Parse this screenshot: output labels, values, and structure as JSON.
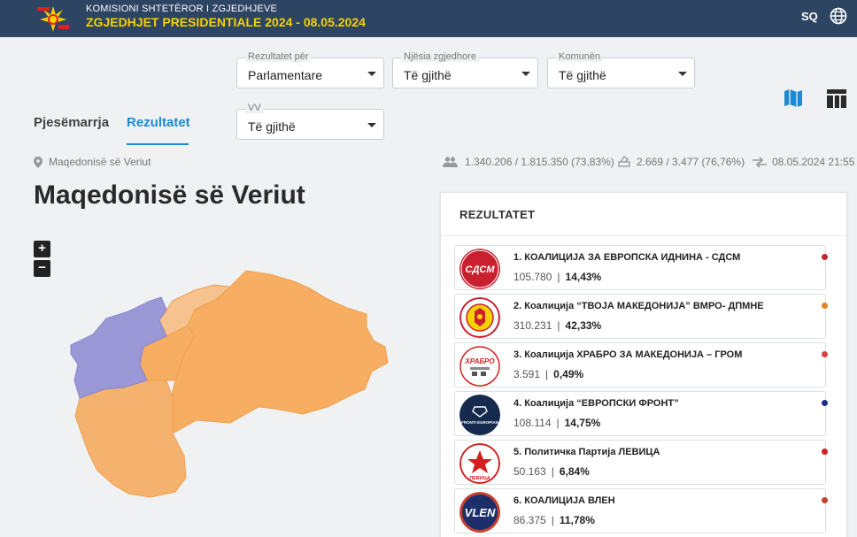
{
  "header": {
    "subtitle": "KOMISIONI SHTETËROR I ZGJEDHJEVE",
    "title": "ZGJEDHJET PRESIDENTIALE 2024 - 08.05.2024",
    "language": "SQ"
  },
  "filters": {
    "results_for": {
      "label": "Rezultatet për",
      "value": "Parlamentare"
    },
    "electoral_unit": {
      "label": "Njësia zgjedhore",
      "value": "Të gjithë"
    },
    "municipality": {
      "label": "Komunën",
      "value": "Të gjithë"
    },
    "polling_station": {
      "label": "VV",
      "value": "Të gjithë"
    }
  },
  "tabs": [
    {
      "label": "Pjesëmarrja",
      "active": false
    },
    {
      "label": "Rezultatet",
      "active": true
    }
  ],
  "info": {
    "location": "Maqedonisë së Veriut",
    "voters": "1.340.206 / 1.815.350 (73,83%)",
    "stations": "2.669 / 3.477 (76,76%)",
    "updated": "08.05.2024 21:55"
  },
  "region_title": "Maqedonisë së Veriut",
  "zoom": {
    "in": "+",
    "out": "−"
  },
  "results": {
    "title": "REZULTATET",
    "parties": [
      {
        "name": "1. КОАЛИЦИЈА ЗА ЕВРОПСКА ИДНИНА - СДСМ",
        "votes": "105.780",
        "percent": "14,43%",
        "color": "#c0282d",
        "logo_text": "СДСМ",
        "logo_bg": "#c8202f",
        "logo_fg": "#ffffff"
      },
      {
        "name": "2. Коалиција “ТВОЈА МАКЕДОНИЈА” ВМРО- ДПМНЕ",
        "votes": "310.231",
        "percent": "42,33%",
        "color": "#e8821e",
        "logo_text": "",
        "logo_bg": "#ffffff",
        "logo_fg": "#c8202f"
      },
      {
        "name": "3. Коалиција ХРАБРО ЗА МАКЕДОНИЈА – ГРОМ",
        "votes": "3.591",
        "percent": "0,49%",
        "color": "#d94040",
        "logo_text": "ХРАБРО",
        "logo_bg": "#ffffff",
        "logo_fg": "#d0251f"
      },
      {
        "name": "4. Коалиција “ЕВРОПСКИ ФРОНТ”",
        "votes": "108.114",
        "percent": "14,75%",
        "color": "#1a2e8c",
        "logo_text": "FRONTI EUROPIAN",
        "logo_bg": "#162a4e",
        "logo_fg": "#ffffff"
      },
      {
        "name": "5. Политичка Партија ЛЕВИЦА",
        "votes": "50.163",
        "percent": "6,84%",
        "color": "#d42020",
        "logo_text": "ЛЕВИЦА",
        "logo_bg": "#ffffff",
        "logo_fg": "#d42020"
      },
      {
        "name": "6. КОАЛИЦИЈА ВЛЕН",
        "votes": "86.375",
        "percent": "11,78%",
        "color": "#c8402e",
        "logo_text": "VLEN",
        "logo_bg": "#1c2f6b",
        "logo_fg": "#ffffff"
      }
    ]
  },
  "colors": {
    "topbar": "#2e4463",
    "accent": "#1b8ad3",
    "map_orange": "#f7ad62",
    "map_light": "#f6c28f",
    "map_purple": "#9a97d6"
  },
  "icons": [
    "ballot-logo-icon",
    "globe-icon",
    "map-view-icon",
    "table-view-icon",
    "location-pin-icon",
    "voters-icon",
    "ballot-box-icon",
    "update-arrows-icon",
    "caret-down-icon"
  ]
}
